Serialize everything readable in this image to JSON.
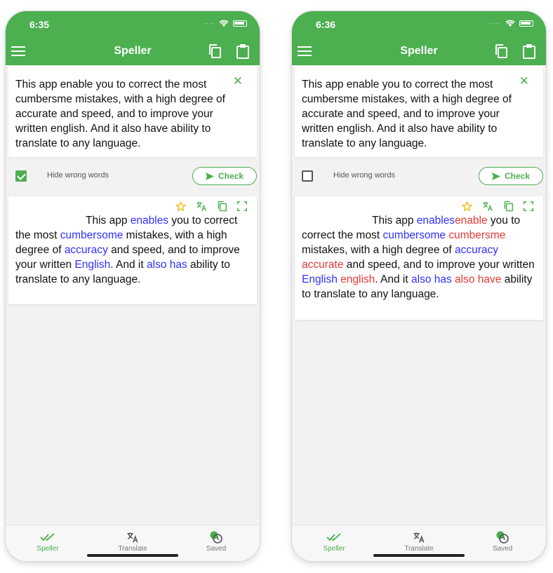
{
  "colors": {
    "primary": "#4caf50",
    "correction": "#3030ff",
    "wrong": "#e53935"
  },
  "app": {
    "title": "Speller"
  },
  "input_text": "This app enable you to correct the most cumbersme mistakes, with a high degree of accurate and speed, and to improve your written english. And it also have ability to translate to any language.",
  "controls": {
    "hide_label": "Hide wrong words",
    "check_label": "Check"
  },
  "screens": [
    {
      "time": "6:35",
      "hide_wrong_checked": true,
      "result": {
        "w1": "This app",
        "c1": "enables",
        "w2": "you to correct the most",
        "c2": "cumbersome",
        "w3": "mistakes, with a high degree of",
        "c3": "accuracy",
        "w4": "and speed, and to improve your written",
        "c4": "English",
        "w5": ". And it",
        "c5": "also has",
        "w6": "ability to translate to any language."
      }
    },
    {
      "time": "6:36",
      "hide_wrong_checked": false,
      "result": {
        "w1": "This app",
        "c1": "enables",
        "x1": "enable",
        "w2": "you to correct the most",
        "c2": "cumbersome",
        "x2": "cumbersme",
        "w3": "mistakes, with a high degree of",
        "c3": "accuracy",
        "x3": "accurate",
        "w4": "and speed, and to improve your written",
        "c4": "English",
        "x4": "english",
        "w5": ". And it",
        "c5": "also has",
        "x5": "also have",
        "w6": "ability to translate to any language."
      }
    }
  ],
  "nav": [
    {
      "label": "Speller",
      "icon": "double-check-icon"
    },
    {
      "label": "Translate",
      "icon": "translate-icon"
    },
    {
      "label": "Saved",
      "icon": "history-icon"
    }
  ]
}
